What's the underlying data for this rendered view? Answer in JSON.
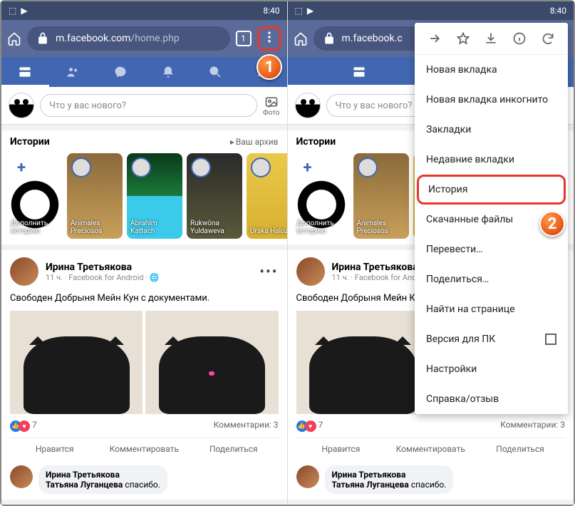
{
  "status": {
    "time": "8:40"
  },
  "chrome": {
    "url_domain": "m.facebook.com",
    "url_path": "/home.php",
    "url_short": "m.facebook.c",
    "tab_count": "1"
  },
  "composer": {
    "placeholder": "Что у вас нового?",
    "photo": "Фото"
  },
  "stories": {
    "title": "Истории",
    "archive": "Ваш архив",
    "items": [
      {
        "name": "Дополнить историю"
      },
      {
        "name": "Animales Preciosos"
      },
      {
        "name": "Abrahîm Kattach"
      },
      {
        "name": "Rukwöna Yuldaweva"
      },
      {
        "name": "Urska Halozan"
      }
    ]
  },
  "post": {
    "username": "Ирина Третьякова",
    "time": "11 ч. · Facebook for Android · 🌐",
    "text": "Свободен Добрыня Мейн Кун с документами.",
    "text_trunc": "Свободен Добрыня Мейн К",
    "likes": "7",
    "comments": "Комментарии: 3",
    "actions": {
      "like": "Нравится",
      "comment": "Комментировать",
      "share": "Поделиться"
    }
  },
  "comment": {
    "name": "Ирина Третьякова",
    "reply_to": "Татьяна Луганцева",
    "text": "спасибо."
  },
  "menu": {
    "new_tab": "Новая вкладка",
    "incognito": "Новая вкладка инкогнито",
    "bookmarks": "Закладки",
    "recent": "Недавние вкладки",
    "history": "История",
    "downloads": "Скачанные файлы",
    "translate": "Перевести…",
    "share": "Поделиться…",
    "find": "Найти на странице",
    "desktop": "Версия для ПК",
    "settings": "Настройки",
    "help": "Справка/отзыв"
  },
  "badges": {
    "1": "1",
    "2": "2"
  }
}
